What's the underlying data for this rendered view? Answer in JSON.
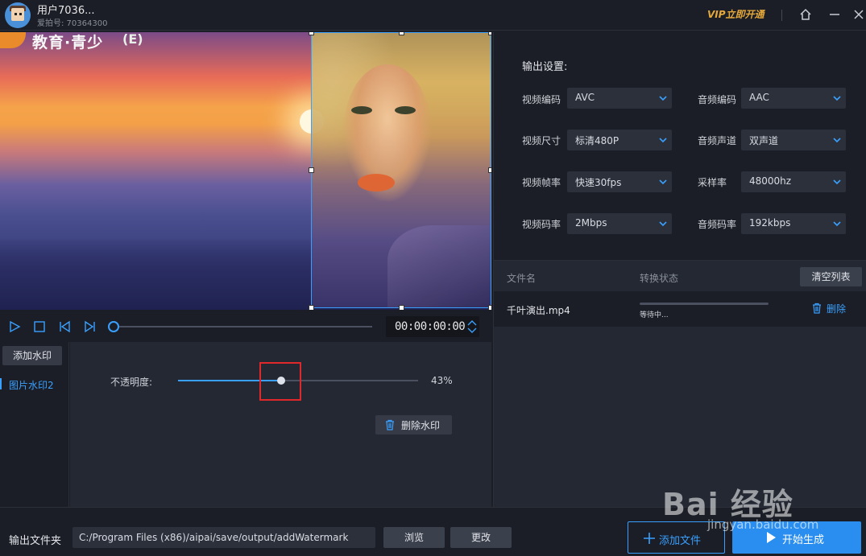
{
  "user": {
    "name": "用户7036...",
    "id_label": "爱拍号: 70364300"
  },
  "header": {
    "vip_label": "VIP立即开通"
  },
  "player": {
    "timecode": "00:00:00:00"
  },
  "watermark": {
    "add_button": "添加水印",
    "items": [
      {
        "label": "图片水印2"
      }
    ],
    "opacity_label": "不透明度:",
    "opacity_value": "43%",
    "opacity": 0.43,
    "delete_button": "删除水印"
  },
  "settings": {
    "title": "输出设置:",
    "left": [
      {
        "label": "视频编码",
        "value": "AVC"
      },
      {
        "label": "视频尺寸",
        "value": "标清480P"
      },
      {
        "label": "视频帧率",
        "value": "快速30fps"
      },
      {
        "label": "视频码率",
        "value": "2Mbps"
      }
    ],
    "right": [
      {
        "label": "音频编码",
        "value": "AAC"
      },
      {
        "label": "音频声道",
        "value": "双声道"
      },
      {
        "label": "采样率",
        "value": "48000hz"
      },
      {
        "label": "音频码率",
        "value": "192kbps"
      }
    ]
  },
  "file_list": {
    "col_name": "文件名",
    "col_status": "转换状态",
    "clear_button": "清空列表",
    "rows": [
      {
        "name": "千叶演出.mp4",
        "status": "等待中...",
        "delete": "删除",
        "progress": 0
      }
    ]
  },
  "output": {
    "label": "输出文件夹",
    "path": "C:/Program Files (x86)/aipai/save/output/addWatermark",
    "browse_button": "浏览",
    "change_button": "更改"
  },
  "actions": {
    "add_file": "添加文件",
    "start": "开始生成"
  },
  "video_overlay": {
    "logo_text": "教育·青少",
    "logo_mark": "(E)"
  },
  "page_watermark": {
    "brand": "Bai 经验",
    "url": "jingyan.baidu.com"
  },
  "colors": {
    "accent": "#3aa0ff",
    "vip": "#e5a93b",
    "highlight": "#e0282a",
    "start_button": "#2a8ef0"
  }
}
